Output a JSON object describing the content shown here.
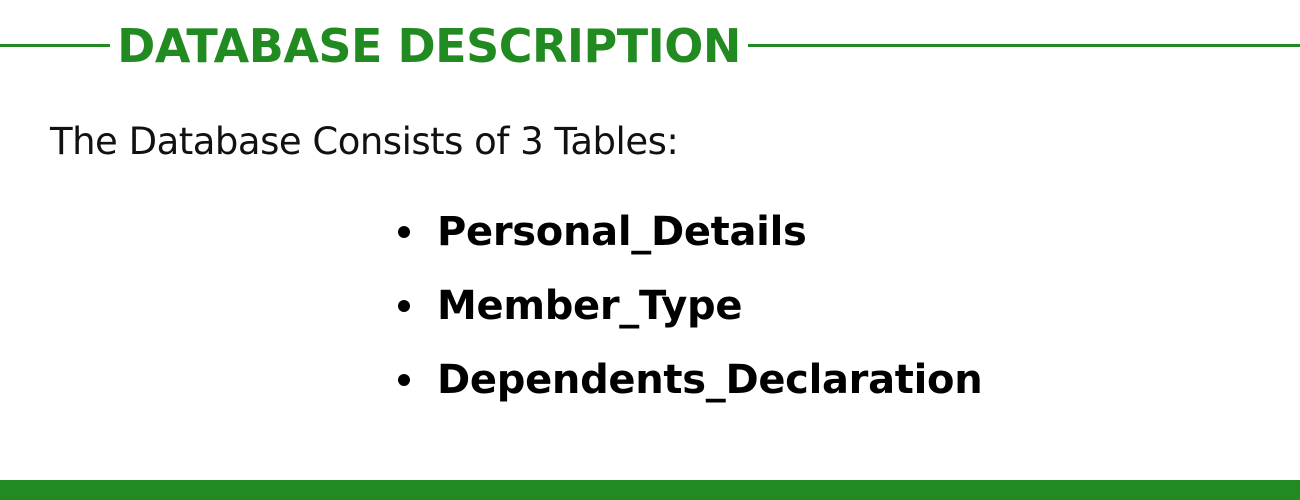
{
  "colors": {
    "accent": "#218a21",
    "text": "#111111"
  },
  "header": {
    "title": "DATABASE DESCRIPTION"
  },
  "intro": {
    "text": "The Database Consists of 3 Tables:"
  },
  "tables": [
    {
      "label": "Personal_Details"
    },
    {
      "label": "Member_Type"
    },
    {
      "label": "Dependents_Declaration"
    }
  ]
}
